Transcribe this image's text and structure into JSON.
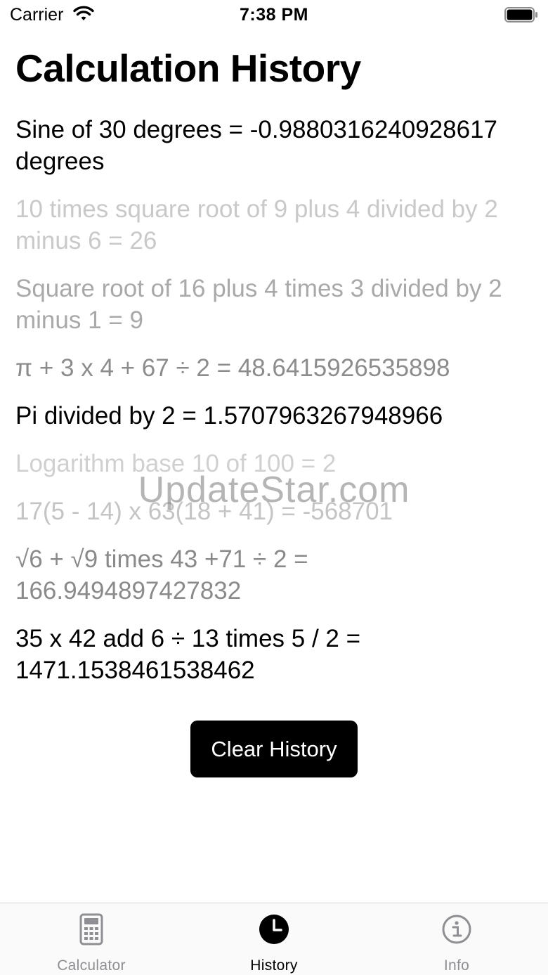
{
  "status_bar": {
    "carrier": "Carrier",
    "time": "7:38 PM"
  },
  "title": "Calculation History",
  "history": [
    {
      "text": "Sine of 30 degrees = -0.9880316240928617 degrees",
      "color": "#000000"
    },
    {
      "text": "10 times square root of 9 plus 4 divided by 2 minus 6 = 26",
      "color": "#c9c9c9"
    },
    {
      "text": "Square root of 16 plus 4 times 3 divided by 2 minus 1 = 9",
      "color": "#a9a9a9"
    },
    {
      "text": "π + 3 x 4 + 67 ÷ 2 = 48.6415926535898",
      "color": "#8c8c8c"
    },
    {
      "text": "Pi divided by 2 = 1.5707963267948966",
      "color": "#000000"
    },
    {
      "text": "Logarithm base 10 of 100 = 2",
      "color": "#d0d0d0"
    },
    {
      "text": "17(5 - 14) x 63(18 + 41) = -568701",
      "color": "#c4c4c4"
    },
    {
      "text": "√6 + √9 times 43 +71 ÷ 2 = 166.9494897427832",
      "color": "#8a8a8a"
    },
    {
      "text": "35 x 42 add 6 ÷ 13 times 5 / 2 = 1471.1538461538462",
      "color": "#000000"
    }
  ],
  "clear_button_label": "Clear History",
  "watermark": "UpdateStar.com",
  "tabs": [
    {
      "id": "calculator",
      "label": "Calculator",
      "icon": "calculator-icon",
      "active": false
    },
    {
      "id": "history",
      "label": "History",
      "icon": "clock-icon",
      "active": true
    },
    {
      "id": "info",
      "label": "Info",
      "icon": "info-icon",
      "active": false
    }
  ],
  "colors": {
    "active_tab": "#000000",
    "inactive_tab": "#8e8e93",
    "button_bg": "#000000",
    "button_text": "#ffffff"
  }
}
